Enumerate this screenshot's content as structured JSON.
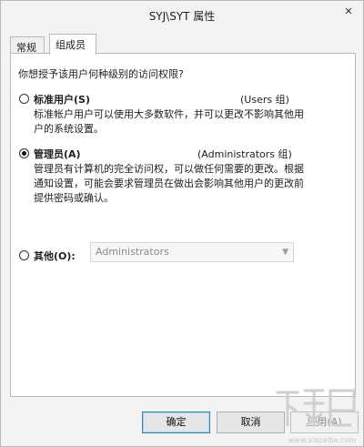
{
  "window": {
    "title": "SYJ\\SYT 属性",
    "close_glyph": "✕"
  },
  "tabs": [
    {
      "label": "常规",
      "active": false
    },
    {
      "label": "组成员",
      "active": true
    }
  ],
  "panel": {
    "question": "你想授予该用户何种级别的访问权限?",
    "options": [
      {
        "label": "标准用户(S)",
        "group": "(Users 组)",
        "checked": false,
        "desc_lines": [
          "标准帐户用户可以使用大多数软件，并可以更改不影响其他用",
          "户的系统设置。"
        ]
      },
      {
        "label": "管理员(A)",
        "group": "(Administrators 组)",
        "checked": true,
        "desc_lines": [
          "管理员有计算机的完全访问权，可以做任何需要的更改。根据",
          "通知设置，可能会要求管理员在做出会影响其他用户的更改前",
          "提供密码或确认。"
        ]
      },
      {
        "label": "其他(O):",
        "checked": false,
        "select_value": "Administrators",
        "select_disabled": true
      }
    ]
  },
  "buttons": {
    "ok": "确定",
    "cancel": "取消",
    "apply": "应用(A)"
  },
  "watermark": {
    "text": "下载吧",
    "url_text": "www.xiazaiba.com"
  }
}
